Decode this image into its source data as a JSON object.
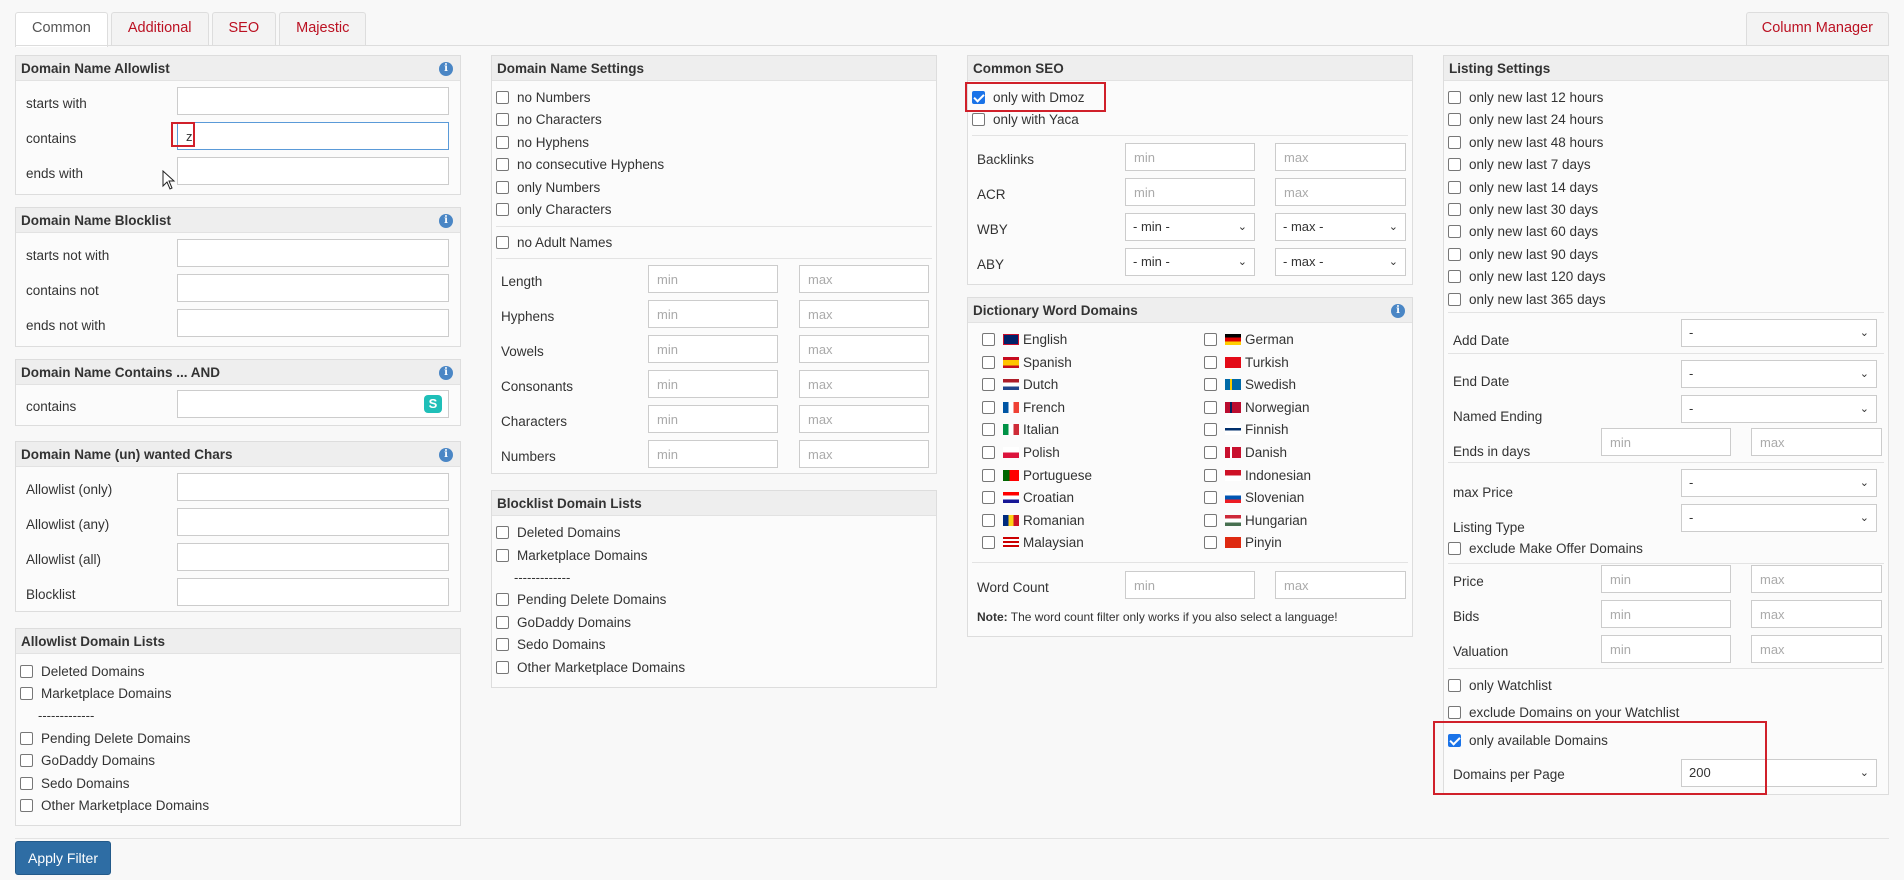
{
  "tabs": [
    "Common",
    "Additional",
    "SEO",
    "Majestic"
  ],
  "column_manager": "Column Manager",
  "allow": {
    "title": "Domain Name Allowlist",
    "starts": "starts with",
    "contains": "contains",
    "ends": "ends with",
    "contains_value": "zi"
  },
  "block": {
    "title": "Domain Name Blocklist",
    "starts": "starts not with",
    "contains": "contains not",
    "ends": "ends not with"
  },
  "contains_and": {
    "title": "Domain Name Contains ... AND",
    "contains": "contains"
  },
  "chars": {
    "title": "Domain Name (un) wanted Chars",
    "only": "Allowlist (only)",
    "any": "Allowlist (any)",
    "all": "Allowlist (all)",
    "block": "Blocklist"
  },
  "allow_lists": {
    "title": "Allowlist Domain Lists",
    "items": [
      "Deleted Domains",
      "Marketplace Domains",
      "Pending Delete Domains",
      "GoDaddy Domains",
      "Sedo Domains",
      "Other Marketplace Domains"
    ],
    "sep": "-------------"
  },
  "name_settings": {
    "title": "Domain Name Settings",
    "checks": [
      "no Numbers",
      "no Characters",
      "no Hyphens",
      "no consecutive Hyphens",
      "only Numbers",
      "only Characters"
    ],
    "adult": "no Adult Names",
    "rows": [
      "Length",
      "Hyphens",
      "Vowels",
      "Consonants",
      "Characters",
      "Numbers"
    ],
    "min": "min",
    "max": "max"
  },
  "block_lists": {
    "title": "Blocklist Domain Lists",
    "items": [
      "Deleted Domains",
      "Marketplace Domains",
      "Pending Delete Domains",
      "GoDaddy Domains",
      "Sedo Domains",
      "Other Marketplace Domains"
    ],
    "sep": "-------------"
  },
  "seo": {
    "title": "Common SEO",
    "dmoz": "only with Dmoz",
    "yaca": "only with Yaca",
    "backlinks": "Backlinks",
    "acr": "ACR",
    "wby": "WBY",
    "aby": "ABY",
    "min": "min",
    "max": "max",
    "min_sel": "- min -",
    "max_sel": "- max -"
  },
  "dict": {
    "title": "Dictionary Word Domains",
    "left": [
      "English",
      "Spanish",
      "Dutch",
      "French",
      "Italian",
      "Polish",
      "Portuguese",
      "Croatian",
      "Romanian",
      "Malaysian"
    ],
    "right": [
      "German",
      "Turkish",
      "Swedish",
      "Norwegian",
      "Finnish",
      "Danish",
      "Indonesian",
      "Slovenian",
      "Hungarian",
      "Pinyin"
    ],
    "word_count": "Word Count",
    "min": "min",
    "max": "max",
    "note_bold": "Note:",
    "note": " The word count filter only works if you also select a language!"
  },
  "listing": {
    "title": "Listing Settings",
    "periods": [
      "only new last 12 hours",
      "only new last 24 hours",
      "only new last 48 hours",
      "only new last 7 days",
      "only new last 14 days",
      "only new last 30 days",
      "only new last 60 days",
      "only new last 90 days",
      "only new last 120 days",
      "only new last 365 days"
    ],
    "add_date": "Add Date",
    "end_date": "End Date",
    "named_ending": "Named Ending",
    "ends_in_days": "Ends in days",
    "max_price": "max Price",
    "listing_type": "Listing Type",
    "dash": "-",
    "exclude_offer": "exclude Make Offer Domains",
    "price": "Price",
    "bids": "Bids",
    "valuation": "Valuation",
    "only_watchlist": "only Watchlist",
    "exclude_watchlist": "exclude Domains on your Watchlist",
    "only_available": "only available Domains",
    "per_page": "Domains per Page",
    "per_page_value": "200",
    "min": "min",
    "max": "max"
  },
  "apply": "Apply Filter",
  "colors": {
    "accent": "#2e6da4",
    "tab_text": "#b12",
    "check": "#1a73e8",
    "highlight": "#d0202a"
  }
}
